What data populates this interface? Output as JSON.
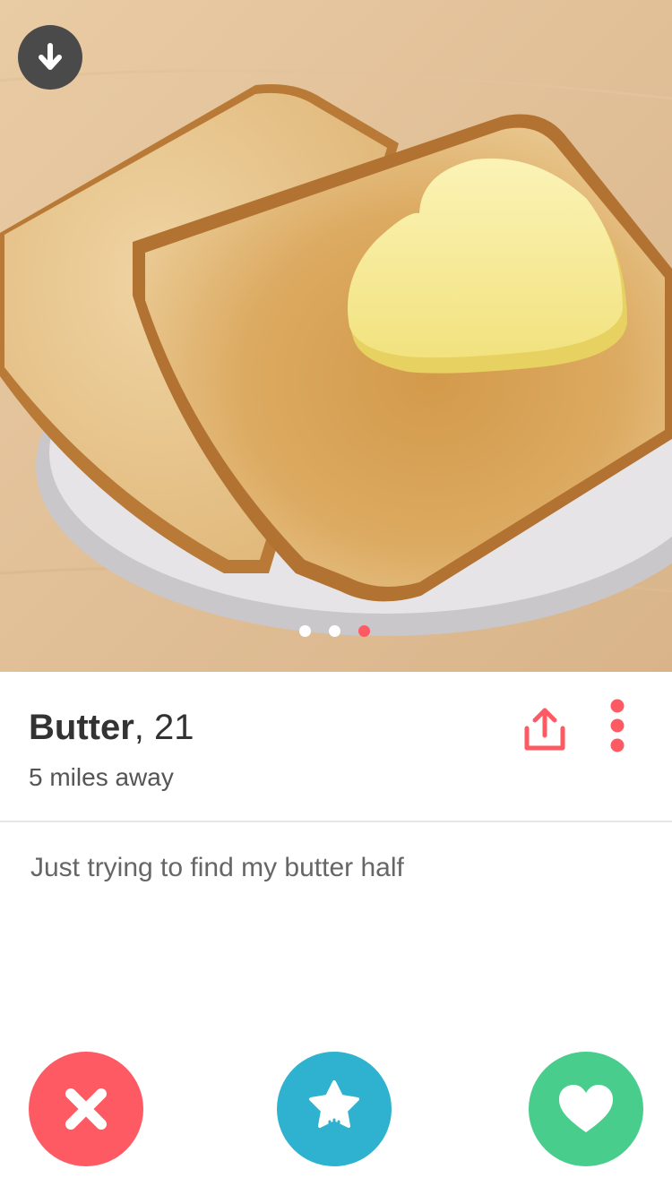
{
  "profile": {
    "name": "Butter",
    "age_text": ", 21",
    "distance": "5 miles away",
    "bio": "Just trying to find my butter half"
  },
  "photo_pager": {
    "count": 3,
    "active_index": 2,
    "active_color": "#fd5a64",
    "inactive_color": "#ffffff"
  },
  "header_controls": {
    "collapse_icon": "arrow-down-icon"
  },
  "profile_actions": {
    "share_icon": "share-icon",
    "more_icon": "more-vertical-icon",
    "accent": "#fd5a64"
  },
  "bottom_actions": [
    {
      "icon": "close-x-icon",
      "color": "#fd5a64"
    },
    {
      "icon": "super-like-star-icon",
      "color": "#2eb2cf"
    },
    {
      "icon": "heart-icon",
      "color": "#48cd8c"
    }
  ]
}
